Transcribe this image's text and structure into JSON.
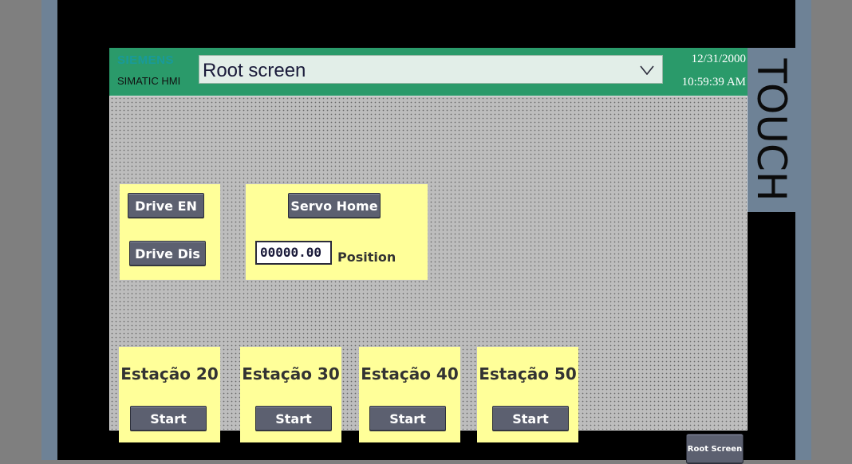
{
  "header": {
    "brand": "SIEMENS",
    "product": "SIMATIC HMI",
    "screen_select": "Root screen",
    "date": "12/31/2000",
    "time": "10:59:39 AM"
  },
  "side_label": "TOUCH",
  "drive_panel": {
    "enable_button": "Drive EN",
    "disable_button": "Drive Dis"
  },
  "servo_panel": {
    "home_button": "Servo Home",
    "position_value": "00000.00",
    "position_label": "Position"
  },
  "stations": [
    {
      "title": "Estação 20",
      "start_label": "Start"
    },
    {
      "title": "Estação 30",
      "start_label": "Start"
    },
    {
      "title": "Estação 40",
      "start_label": "Start"
    },
    {
      "title": "Estação 50",
      "start_label": "Start"
    }
  ],
  "root_screen_button": "Root Screen",
  "colors": {
    "header": "#2a9a6a",
    "panel": "#ffff99",
    "button": "#5c6070",
    "frame": "#6e8296"
  }
}
